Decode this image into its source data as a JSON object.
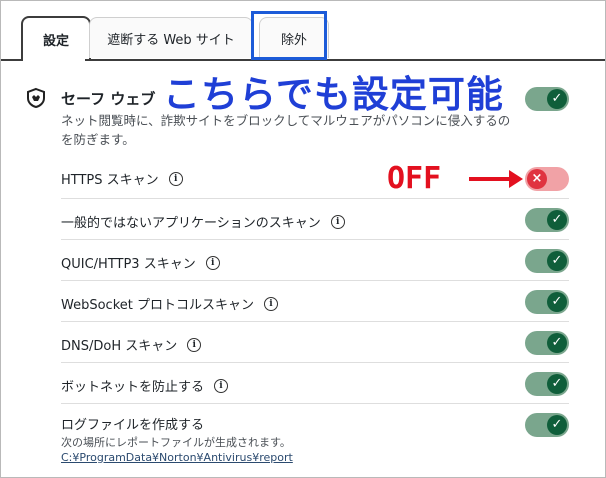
{
  "tabs": [
    {
      "label": "設定"
    },
    {
      "label": "遮断する Web サイト"
    },
    {
      "label": "除外"
    }
  ],
  "annotation": {
    "headline": "こちらでも設定可能",
    "off_label": "OFF"
  },
  "section": {
    "title": "セーフ ウェブ",
    "description": "ネット閲覧時に、詐欺サイトをブロックしてマルウェアがパソコンに侵入するのを防ぎます。",
    "toggle_on": true
  },
  "rows": [
    {
      "label": "HTTPS スキャン",
      "enabled": false
    },
    {
      "label": "一般的ではないアプリケーションのスキャン",
      "enabled": true
    },
    {
      "label": "QUIC/HTTP3 スキャン",
      "enabled": true
    },
    {
      "label": "WebSocket プロトコルスキャン",
      "enabled": true
    },
    {
      "label": "DNS/DoH スキャン",
      "enabled": true
    },
    {
      "label": "ボットネットを防止する",
      "enabled": true
    },
    {
      "label": "ログファイルを作成する",
      "enabled": true,
      "sub": "次の場所にレポートファイルが生成されます。",
      "link": "C:¥ProgramData¥Norton¥Antivirus¥report"
    }
  ],
  "icons": {
    "info": "info-icon",
    "check": "check-icon",
    "close": "close-icon",
    "shield": "shield-icon"
  },
  "colors": {
    "toggle_on_track": "#7aa68d",
    "toggle_on_knob": "#0f5e3a",
    "toggle_off_track": "#f1a2a6",
    "toggle_off_knob": "#e03340",
    "annotation_blue": "#1f3fd6",
    "annotation_red": "#e3101f"
  }
}
